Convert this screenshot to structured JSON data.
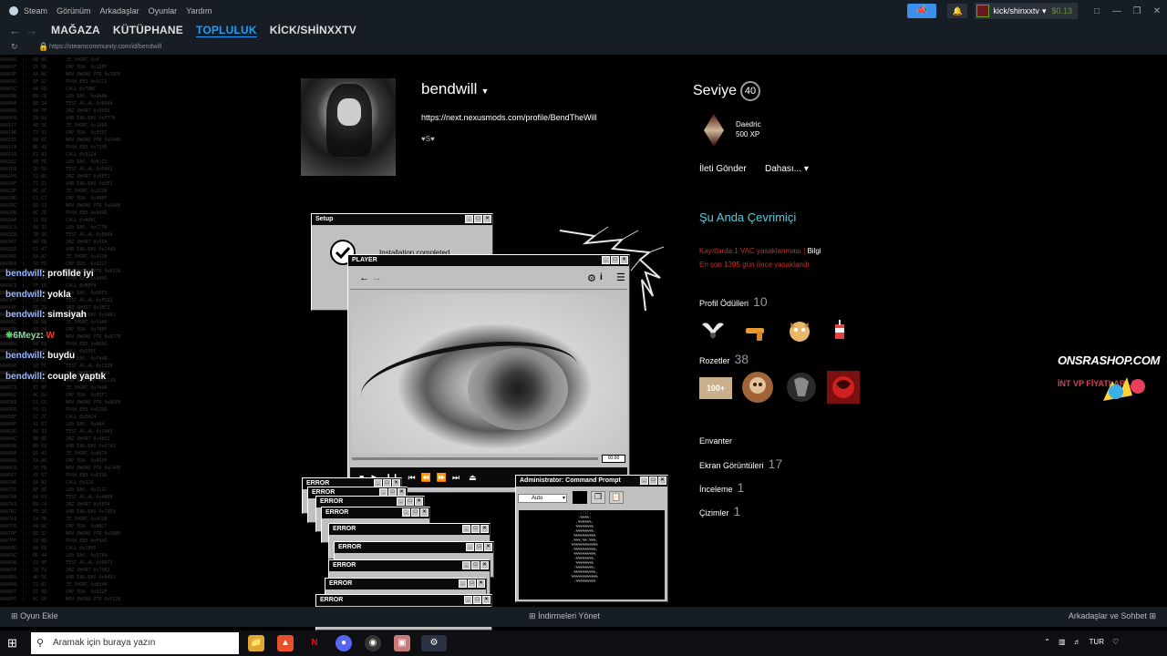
{
  "menubar": {
    "app": "Steam",
    "items": [
      "Görünüm",
      "Arkadaşlar",
      "Oyunlar",
      "Yardım"
    ],
    "account_name": "kick/shinxxtv",
    "balance": "$0.13"
  },
  "nav": {
    "tabs": [
      "MAĞAZA",
      "KÜTÜPHANE",
      "TOPLULUK",
      "KİCK/SHİNXXTV"
    ],
    "active": "TOPLULUK",
    "url": "https://steamcommunity.com/id/bendwill"
  },
  "chat": [
    {
      "user": "bendwill",
      "text": "profilde iyi"
    },
    {
      "user": "bendwill",
      "text": "yokla"
    },
    {
      "user": "bendwill",
      "text": "simsiyah"
    },
    {
      "user": "6Meyz",
      "text": "W"
    },
    {
      "user": "bendwill",
      "text": "buydu"
    },
    {
      "user": "bendwill",
      "text": "couple yaptık"
    }
  ],
  "profile": {
    "name": "bendwill",
    "url": "https://next.nexusmods.com/profile/BendTheWill",
    "summary": "S"
  },
  "sidebar": {
    "level_label": "Seviye",
    "level": "40",
    "badge_name": "Daedric",
    "badge_xp": "500 XP",
    "send_message": "İleti Gönder",
    "more": "Dahası...",
    "online_status": "Şu Anda Çevrimiçi",
    "vac_line": "Kayıtlarda 1 VAC yasaklanması",
    "vac_info": "Bilgi",
    "vac_days": "En son 1395 gün önce yasaklandı",
    "awards_label": "Profil Ödülleri",
    "awards_count": "10",
    "badges_label": "Rozetler",
    "badges_count": "38",
    "inventory_label": "Envanter",
    "screenshots_label": "Ekran Görüntüleri",
    "screenshots_count": "17",
    "reviews_label": "İnceleme",
    "reviews_count": "1",
    "artwork_label": "Çizimler",
    "artwork_count": "1"
  },
  "windows": {
    "setup_title": "Setup",
    "setup_text": "Installation completed",
    "player_title": "PLAYER",
    "player_time": "00:00",
    "cmd_title": "Administrator: Command Prompt",
    "cmd_select": "Auto",
    "error_title": "ERROR"
  },
  "overlay": {
    "brand": "ONSRASHOP.COM",
    "brand_sub": "İNT VP FİYATLARLA"
  },
  "bottombar": {
    "add_game": "Oyun Ekle",
    "downloads": "İndirmeleri Yönet",
    "friends": "Arkadaşlar ve Sohbet"
  },
  "taskbar": {
    "search_placeholder": "Aramak için buraya yazın",
    "lang": "TUR"
  },
  "colors": {
    "steam_bar": "#171d25",
    "accent": "#1a9fff",
    "online": "#57cbde",
    "vac": "#c0302a"
  }
}
